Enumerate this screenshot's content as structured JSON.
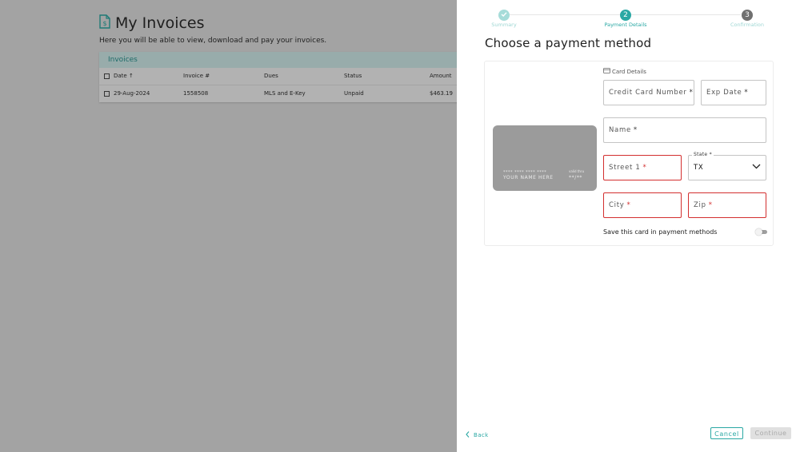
{
  "background": {
    "page_title": "My Invoices",
    "page_subtitle": "Here you will be able to view, download and pay your invoices.",
    "invoices_card": {
      "title": "Invoices",
      "columns": [
        "Date",
        "Invoice #",
        "Dues",
        "Status",
        "Amount"
      ],
      "rows": [
        {
          "date": "29-Aug-2024",
          "invoice": "1558508",
          "dues": "MLS and E-Key",
          "status": "Unpaid",
          "amount": "$463.19"
        }
      ]
    }
  },
  "panel": {
    "steps": [
      {
        "label": "Summary",
        "number": "",
        "state": "done"
      },
      {
        "label": "Payment Details",
        "number": "2",
        "state": "active"
      },
      {
        "label": "Confirmation",
        "number": "3",
        "state": "pending"
      }
    ],
    "title": "Choose a payment method",
    "card_preview": {
      "number_mask": "**** **** **** ****",
      "holder": "YOUR NAME HERE",
      "valid_label": "valid thru",
      "expiry_mask": "**/**"
    },
    "section_label": "Card Details",
    "fields": {
      "card_number": "Credit Card Number",
      "exp_date": "Exp Date",
      "name": "Name",
      "street": "Street 1",
      "state_legend": "State *",
      "state_value": "TX",
      "city": "City",
      "zip": "Zip"
    },
    "required_mark": "*",
    "save_card_label": "Save this card in payment methods",
    "back_label": "Back",
    "cancel_label": "Cancel",
    "continue_label": "Continue"
  },
  "colors": {
    "accent": "#2aa8a4",
    "error": "#d32f2f",
    "overlay": "#a3a3a3"
  },
  "icons": [
    "invoice-dollar-icon",
    "sort-arrow-up-icon",
    "check-icon",
    "card-icon",
    "chevron-down-icon",
    "chevron-left-icon"
  ]
}
